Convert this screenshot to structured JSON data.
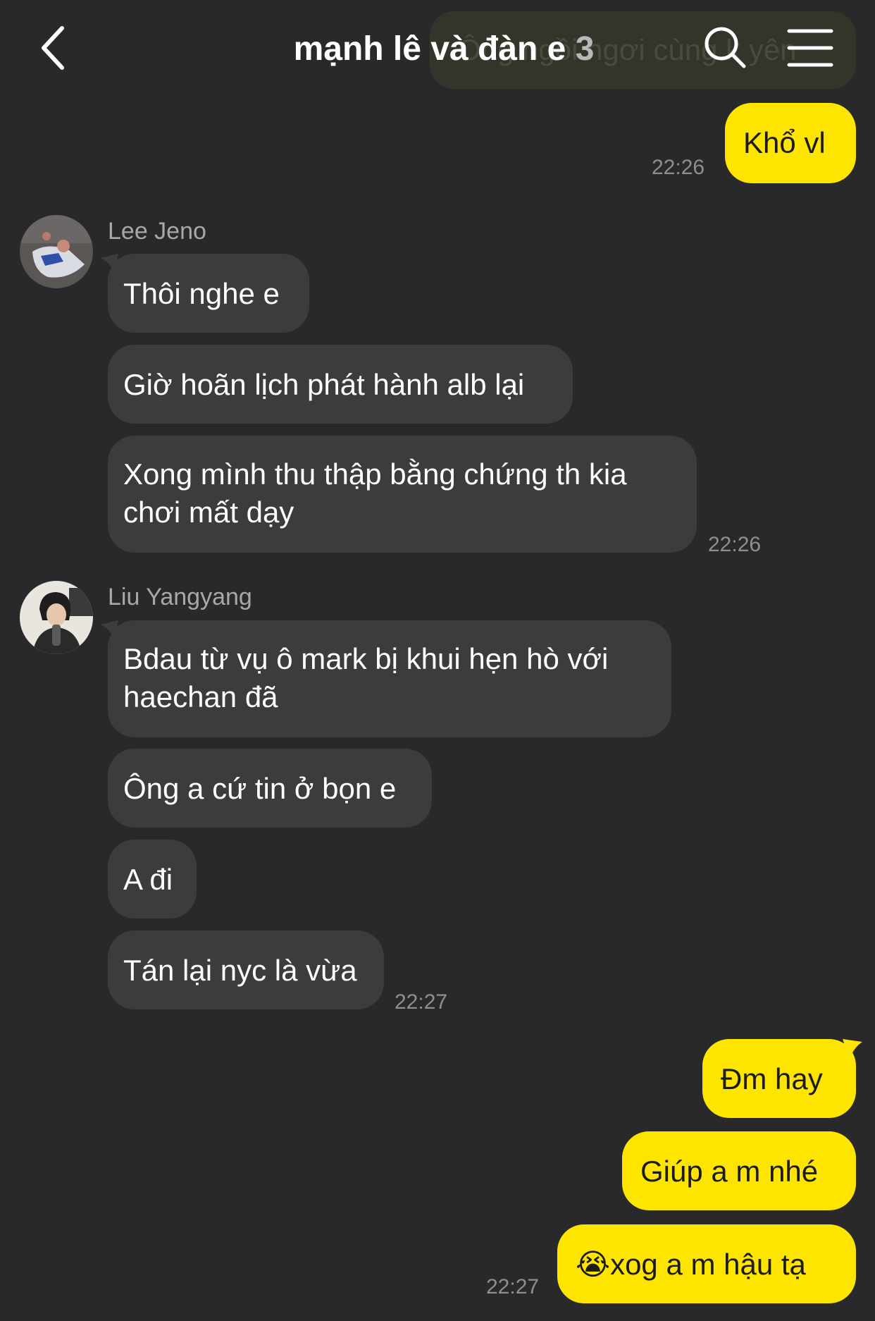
{
  "header": {
    "title": "mạnh lê và đàn e",
    "member_count": "3",
    "ghost_text": "Ông ngồi ngơi cùng k yên"
  },
  "messages": [
    {
      "id": "m1",
      "sender": "me",
      "text": "Khổ vl"
    },
    {
      "id": "m2",
      "sender": "Lee Jeno",
      "text": "Thôi nghe e"
    },
    {
      "id": "m3",
      "sender": "Lee Jeno",
      "text": "Giờ hoãn lịch phát hành alb lại"
    },
    {
      "id": "m4",
      "sender": "Lee Jeno",
      "lines": [
        "Xong mình thu thập bằng chứng th kia",
        "chơi mất dạy"
      ]
    },
    {
      "id": "m5",
      "sender": "Liu Yangyang",
      "lines": [
        "Bdau từ vụ ô mark bị khui hẹn hò với",
        "haechan đã"
      ]
    },
    {
      "id": "m6",
      "sender": "Liu Yangyang",
      "text": "Ông a cứ tin ở bọn e"
    },
    {
      "id": "m7",
      "sender": "Liu Yangyang",
      "text": "A đi"
    },
    {
      "id": "m8",
      "sender": "Liu Yangyang",
      "text": "Tán lại nyc là vừa"
    },
    {
      "id": "m9",
      "sender": "me",
      "text": "Đm hay"
    },
    {
      "id": "m10",
      "sender": "me",
      "text": "Giúp a m nhé"
    },
    {
      "id": "m11",
      "sender": "me",
      "emoji": "😭",
      "text": "xog a m hậu tạ"
    }
  ],
  "senders": {
    "jeno": "Lee Jeno",
    "yangyang": "Liu Yangyang"
  },
  "times": {
    "t1": "22:26",
    "t2": "22:26",
    "t3": "22:27",
    "t4": "22:27"
  },
  "colors": {
    "background": "#29292c",
    "incoming_bubble": "#3c3c3f",
    "outgoing_bubble": "#fee500",
    "timestamp": "#8e8e8e"
  },
  "icons": {
    "back": "chevron-left-icon",
    "search": "search-icon",
    "menu": "hamburger-menu-icon"
  }
}
